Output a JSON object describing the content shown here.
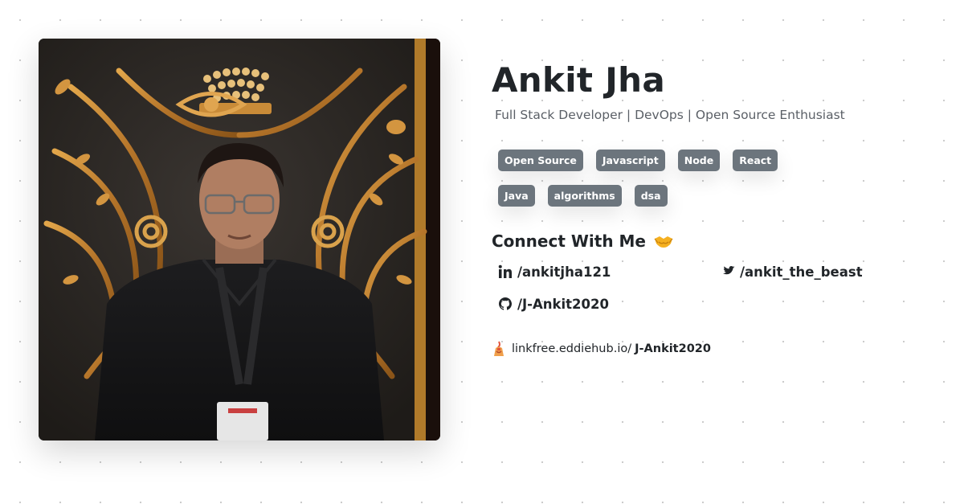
{
  "profile": {
    "name": "Ankit Jha",
    "subtitle": "Full Stack Developer | DevOps | Open Source Enthusiast"
  },
  "tags": [
    "Open Source",
    "Javascript",
    "Node",
    "React",
    "Java",
    "algorithms",
    "dsa"
  ],
  "connect": {
    "title": "Connect With Me",
    "title_emoji_icon": "handshake-icon",
    "links": [
      {
        "icon": "linkedin-icon",
        "label": "/ankitjha121"
      },
      {
        "icon": "twitter-icon",
        "label": "/ankit_the_beast"
      },
      {
        "icon": "github-icon",
        "label": "/J-Ankit2020"
      }
    ]
  },
  "linkfree": {
    "icon": "linkfree-logo-icon",
    "domain": "linkfree.eddiehub.io/",
    "username": "J-Ankit2020"
  },
  "colors": {
    "tag_background": "#6c757d",
    "text": "#212529",
    "subtitle": "#5a5f66",
    "background_dots": "#c9c9c9"
  }
}
